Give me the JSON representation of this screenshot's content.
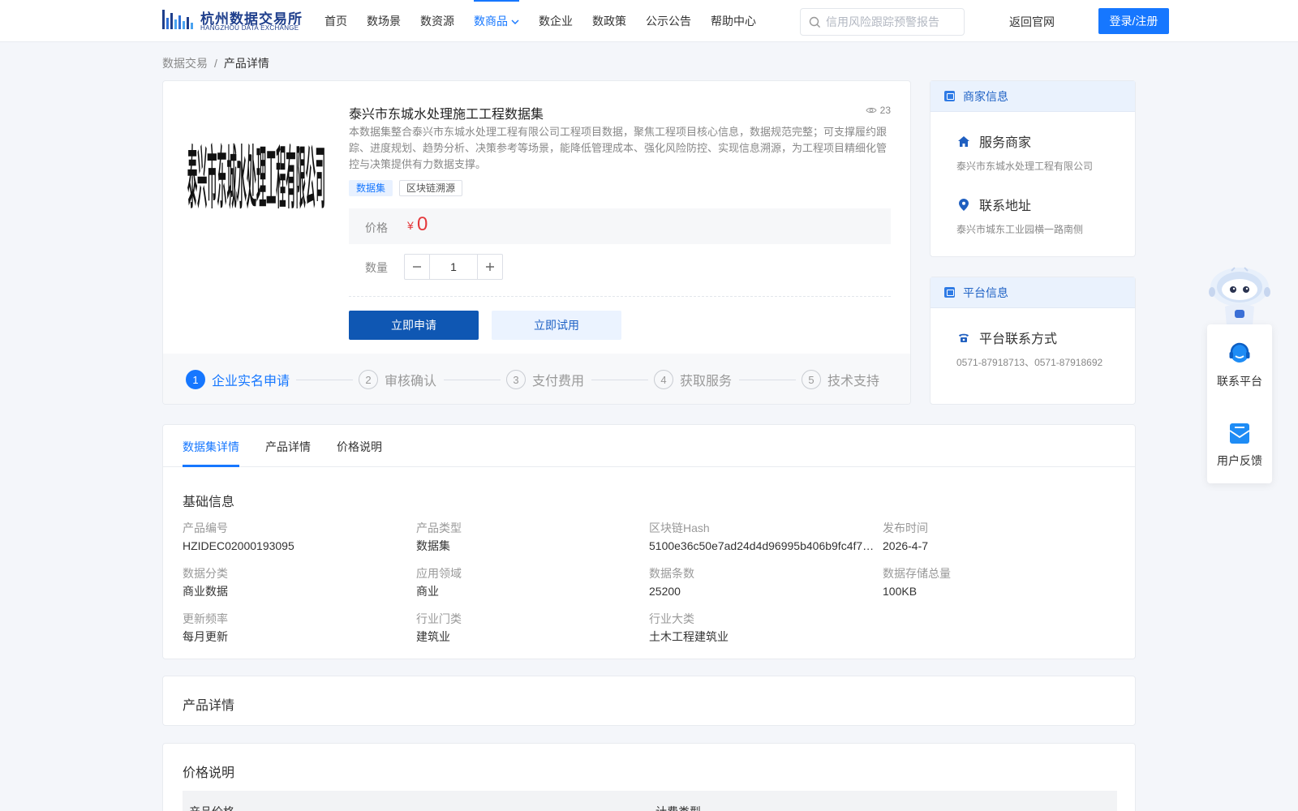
{
  "header": {
    "logo_cn": "杭州数据交易所",
    "logo_en": "HANGZHOU DATA EXCHANGE",
    "nav": [
      {
        "label": "首页"
      },
      {
        "label": "数场景"
      },
      {
        "label": "数资源"
      },
      {
        "label": "数商品"
      },
      {
        "label": "数企业"
      },
      {
        "label": "数政策"
      },
      {
        "label": "公示公告"
      },
      {
        "label": "帮助中心"
      }
    ],
    "active_nav": "数商品",
    "search_placeholder": "信用风险跟踪预警报告",
    "back_link": "返回官网",
    "login": "登录/注册"
  },
  "breadcrumb": {
    "root": "数据交易",
    "sep": "/",
    "current": "产品详情"
  },
  "product": {
    "image_text": "泰兴市东城水处理工程有限公司",
    "title": "泰兴市东城水处理施工工程数据集",
    "views": "23",
    "description": "本数据集整合泰兴市东城水处理工程有限公司工程项目数据，聚焦工程项目核心信息，数据规范完整；可支撑履约跟踪、进度规划、趋势分析、决策参考等场景，能降低管理成本、强化风险防控、实现信息溯源，为工程项目精细化管控与决策提供有力数据支撑。",
    "tags": [
      "数据集",
      "区块链溯源"
    ],
    "price_label": "价格",
    "price_symbol": "¥",
    "price_value": "0",
    "qty_label": "数量",
    "qty_value": "1",
    "apply_button": "立即申请",
    "trial_button": "立即试用",
    "steps": [
      {
        "num": "1",
        "label": "企业实名申请"
      },
      {
        "num": "2",
        "label": "审核确认"
      },
      {
        "num": "3",
        "label": "支付费用"
      },
      {
        "num": "4",
        "label": "获取服务"
      },
      {
        "num": "5",
        "label": "技术支持"
      }
    ]
  },
  "merchant": {
    "header": "商家信息",
    "service_title": "服务商家",
    "service_value": "泰兴市东城水处理工程有限公司",
    "address_title": "联系地址",
    "address_value": "泰兴市城东工业园横一路南侧"
  },
  "platform": {
    "header": "平台信息",
    "contact_title": "平台联系方式",
    "contact_value": "0571-87918713、0571-87918692"
  },
  "detail": {
    "tabs": [
      "数据集详情",
      "产品详情",
      "价格说明"
    ],
    "basic_title": "基础信息",
    "fields": [
      {
        "label": "产品编号",
        "value": "HZIDEC02000193095"
      },
      {
        "label": "产品类型",
        "value": "数据集"
      },
      {
        "label": "区块链Hash",
        "value": "5100e36c50e7ad24d4d96995b406b9fc4f7…"
      },
      {
        "label": "发布时间",
        "value": "2026-4-7"
      },
      {
        "label": "数据分类",
        "value": "商业数据"
      },
      {
        "label": "应用领域",
        "value": "商业"
      },
      {
        "label": "数据条数",
        "value": "25200"
      },
      {
        "label": "数据存储总量",
        "value": "100KB"
      },
      {
        "label": "更新频率",
        "value": "每月更新"
      },
      {
        "label": "行业门类",
        "value": "建筑业"
      },
      {
        "label": "行业大类",
        "value": "土木工程建筑业"
      }
    ]
  },
  "product_detail_section": {
    "title": "产品详情"
  },
  "price_section": {
    "title": "价格说明",
    "col1": "产品价格",
    "col2": "计费类型"
  },
  "float_panel": {
    "contact": "联系平台",
    "feedback": "用户反馈"
  },
  "colors": {
    "primary": "#1677ff",
    "dark_primary": "#0f57b3",
    "price": "#e4393c"
  }
}
